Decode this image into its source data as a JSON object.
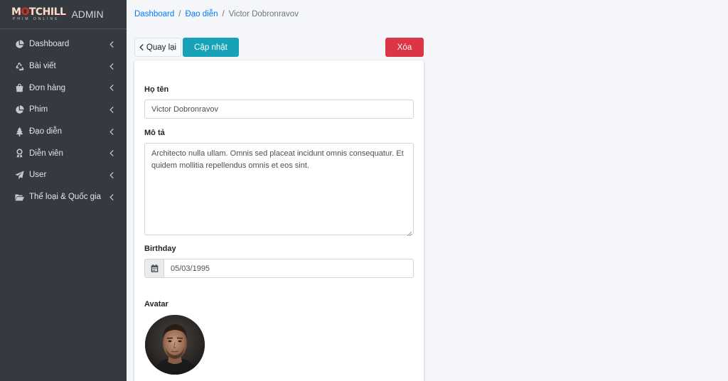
{
  "brand": {
    "logo_main_left": "M",
    "logo_main_o": "O",
    "logo_main_right": "TCHILL",
    "logo_sub": "PHIM ONLINE",
    "admin_label": "ADMIN"
  },
  "sidebar": {
    "items": [
      {
        "label": "Dashboard",
        "icon": "pie-chart-icon"
      },
      {
        "label": "Bài viết",
        "icon": "recycle-icon"
      },
      {
        "label": "Đơn hàng",
        "icon": "shopping-bag-icon"
      },
      {
        "label": "Phim",
        "icon": "pie-chart-icon"
      },
      {
        "label": "Đạo diễn",
        "icon": "tree-icon"
      },
      {
        "label": "Diễn viên",
        "icon": "award-icon"
      },
      {
        "label": "User",
        "icon": "paper-plane-icon"
      },
      {
        "label": "Thể loại & Quốc gia",
        "icon": "folder-open-icon"
      }
    ]
  },
  "breadcrumb": {
    "home": "Dashboard",
    "section": "Đạo diễn",
    "current": "Victor Dobronravov",
    "separator": "/"
  },
  "actions": {
    "back_label": "Quay lại",
    "update_label": "Cập nhật",
    "delete_label": "Xóa"
  },
  "form": {
    "name_label": "Họ tên",
    "name_value": "Victor Dobronravov",
    "description_label": "Mô tả",
    "description_value": "Architecto nulla ullam. Omnis sed placeat incidunt omnis consequatur. Et quidem mollitia repellendus omnis et eos sint.",
    "birthday_label": "Birthday",
    "birthday_value": "05/03/1995",
    "avatar_label": "Avatar"
  },
  "colors": {
    "sidebar_bg": "#343a40",
    "link": "#007bff",
    "update_button": "#17a2b8",
    "delete_button": "#dc3545",
    "page_bg": "#f4f6f9"
  }
}
